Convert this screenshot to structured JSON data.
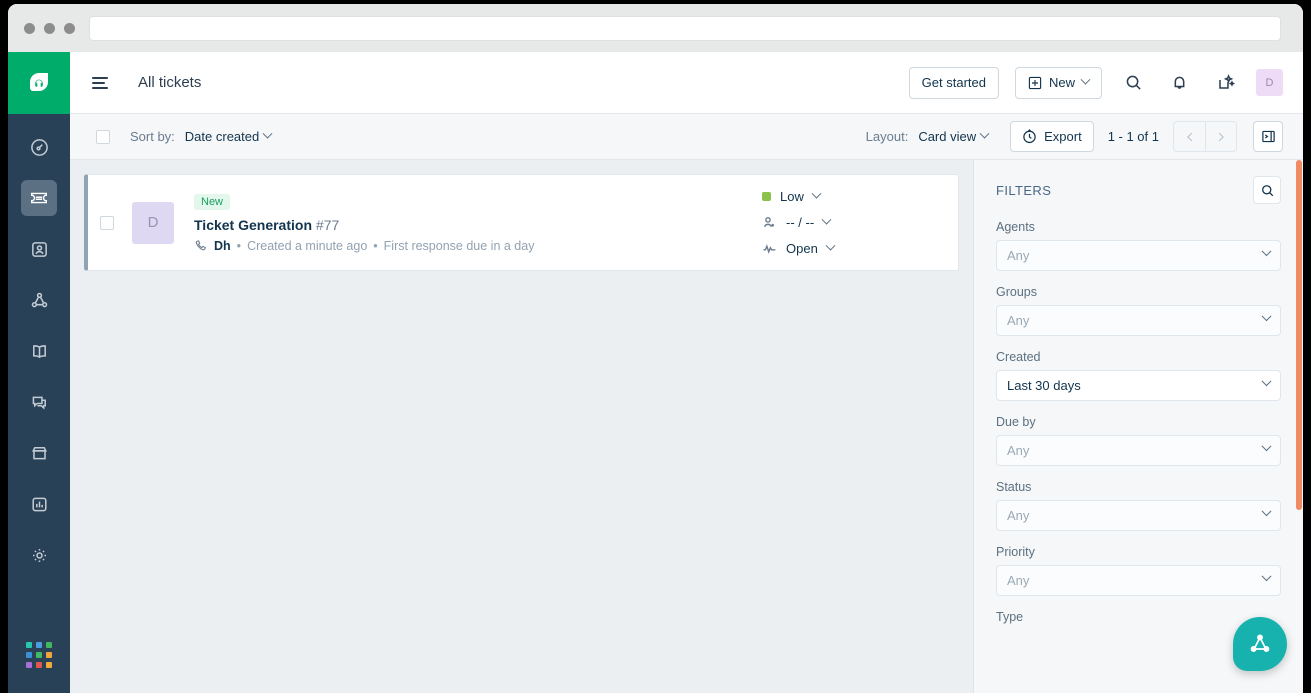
{
  "browser": {
    "url_value": "",
    "url_placeholder": ""
  },
  "brand": {
    "logo_name": "freshdesk-logo",
    "green": "#00ac69",
    "navy": "#294157",
    "accent_teal": "#17b2ad",
    "scrollbar": "#f08a62"
  },
  "sidebar": {
    "items": [
      {
        "icon": "dashboard-gauge-icon",
        "name": "sidebar-item-dashboard",
        "active": false
      },
      {
        "icon": "ticket-icon",
        "name": "sidebar-item-tickets",
        "active": true
      },
      {
        "icon": "contact-card-icon",
        "name": "sidebar-item-contacts",
        "active": false
      },
      {
        "icon": "network-nodes-icon",
        "name": "sidebar-item-social",
        "active": false
      },
      {
        "icon": "book-icon",
        "name": "sidebar-item-solutions",
        "active": false
      },
      {
        "icon": "chat-bubbles-icon",
        "name": "sidebar-item-forums",
        "active": false
      },
      {
        "icon": "marketplace-icon",
        "name": "sidebar-item-marketplace",
        "active": false
      },
      {
        "icon": "bar-chart-icon",
        "name": "sidebar-item-analytics",
        "active": false
      },
      {
        "icon": "gear-icon",
        "name": "sidebar-item-admin",
        "active": false
      }
    ],
    "app_switcher_colors": [
      "#26c6b0",
      "#4a9ede",
      "#3fb95e",
      "#3d8fd6",
      "#43b863",
      "#f2a33c",
      "#a96fd6",
      "#e2574c",
      "#f0a93a"
    ]
  },
  "header": {
    "title": "All tickets",
    "get_started_label": "Get started",
    "new_label": "New",
    "new_icon": "plus-square-icon",
    "search_icon": "search-icon",
    "notifications_icon": "bell-icon",
    "ai_icon": "sparkle-ai-icon",
    "avatar_initial": "D"
  },
  "toolbar": {
    "select_all_checked": false,
    "sort_by_label": "Sort by:",
    "sort_by_value": "Date created",
    "layout_label": "Layout:",
    "layout_value": "Card view",
    "export_label": "Export",
    "export_icon": "clock-export-icon",
    "pagination_count": "1 - 1 of 1",
    "prev_icon": "chevron-left-icon",
    "next_icon": "chevron-right-icon",
    "panel_toggle_icon": "collapse-panel-icon"
  },
  "tickets": [
    {
      "checked": false,
      "avatar_initial": "D",
      "badge": "New",
      "title": "Ticket Generation",
      "number": "#77",
      "channel_icon": "phone-icon",
      "requester": "Dh",
      "created": "Created a minute ago",
      "sla": "First response due in a day",
      "priority": "Low",
      "priority_color": "#8bc34a",
      "agent_icon": "assign-agent-icon",
      "agent": "-- / --",
      "status_icon": "activity-pulse-icon",
      "status": "Open"
    }
  ],
  "filters": {
    "title": "FILTERS",
    "search_icon": "search-icon",
    "groups": [
      {
        "label": "Agents",
        "value": "Any",
        "filled": false
      },
      {
        "label": "Groups",
        "value": "Any",
        "filled": false
      },
      {
        "label": "Created",
        "value": "Last 30 days",
        "filled": true
      },
      {
        "label": "Due by",
        "value": "Any",
        "filled": false
      },
      {
        "label": "Status",
        "value": "Any",
        "filled": false
      },
      {
        "label": "Priority",
        "value": "Any",
        "filled": false
      },
      {
        "label": "Type",
        "value": "",
        "filled": false
      }
    ]
  },
  "fab": {
    "icon": "freshworks-triangle-icon"
  }
}
